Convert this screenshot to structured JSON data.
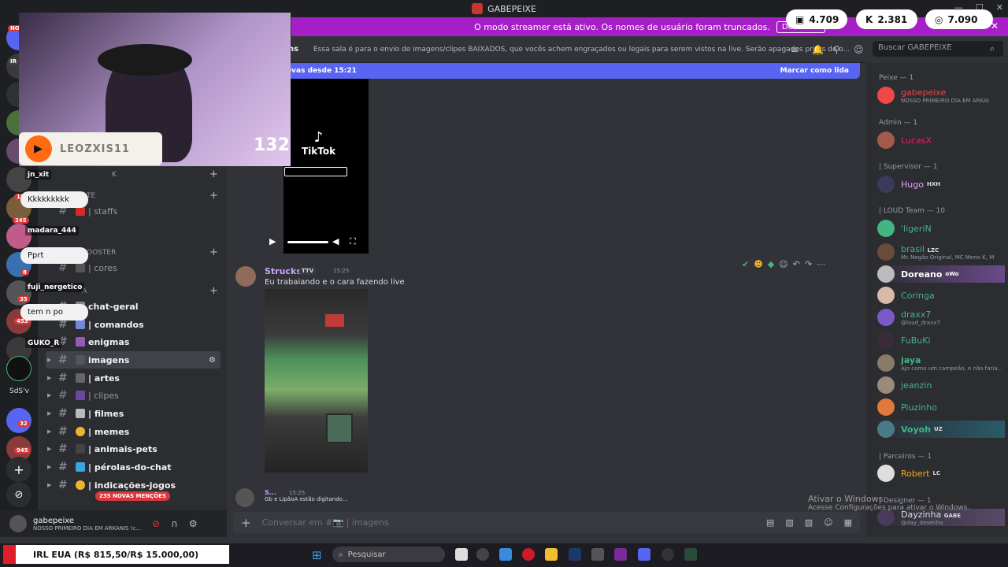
{
  "window": {
    "title": "GABEPEIXE",
    "controls": [
      "—",
      "☐",
      "✕"
    ]
  },
  "banner": {
    "text": "O modo streamer está ativo. Os nomes de usuário foram truncados.",
    "button": "Desativar",
    "close": "✕"
  },
  "stats": [
    {
      "icon": "twitch-icon",
      "value": "4.709"
    },
    {
      "icon": "kick-icon",
      "value": "2.381"
    },
    {
      "icon": "viewers-icon",
      "value": "7.090"
    }
  ],
  "servers": {
    "badges": [
      "NO",
      "IR",
      "245",
      "12",
      "8",
      "35",
      "453",
      "945",
      "32"
    ],
    "labels": [
      "SdS'v"
    ]
  },
  "channels": {
    "categories": [
      "K",
      "TE",
      "BOOSTER",
      "A"
    ],
    "items": [
      {
        "name": "| staffs",
        "bold": false
      },
      {
        "name": "| cores",
        "bold": false
      },
      {
        "name": "chat-geral",
        "bold": true
      },
      {
        "name": "| comandos",
        "bold": true
      },
      {
        "name": "enigmas",
        "bold": true
      },
      {
        "name": "imagens",
        "bold": true,
        "active": true
      },
      {
        "name": "| artes",
        "bold": true
      },
      {
        "name": "| clipes",
        "bold": false
      },
      {
        "name": "| filmes",
        "bold": true
      },
      {
        "name": "| memes",
        "bold": true
      },
      {
        "name": "| animais-pets",
        "bold": true
      },
      {
        "name": "| pérolas-do-chat",
        "bold": true
      },
      {
        "name": "| indicações-jogos",
        "bold": true
      }
    ],
    "mentions": "235 NOVAS MENÇÕES"
  },
  "user": {
    "name": "gabepeixe",
    "status": "NOSSO PRIMEIRO DIA EM ARKANIS !c..."
  },
  "stream": {
    "label": "LEOZXIS11",
    "count": "132",
    "tiktok": "TikTok"
  },
  "chat_overlay": [
    {
      "user": "jn_xit"
    },
    {
      "message": "Kkkkkkkkk"
    },
    {
      "user": "madara_444"
    },
    {
      "message": "Pprt"
    },
    {
      "user": "fuji_nergetico"
    },
    {
      "message": "tem n po"
    },
    {
      "user": "GUKO_R"
    }
  ],
  "topbar": {
    "channel": "ns",
    "topic": "Essa sala é para o envio de imagens/clipes BAIXADOS, que vocês achem engraçados ou legais para serem vistos na live. Serão apagados prints de o...",
    "search_placeholder": "Buscar GABEPEIXE"
  },
  "newbar": {
    "left": "ovas desde 15:21",
    "right": "Marcar como lida"
  },
  "message": {
    "author": "Strucks",
    "tag": "TTV",
    "time": "15:25",
    "text": "Eu trabaiando e o cara fazendo live"
  },
  "next_message": {
    "author": "S...",
    "time": "15:25",
    "typing": "Gb  e LipãoA estão digitando..."
  },
  "composer": {
    "placeholder": "Conversar em #📷 | imagens"
  },
  "members": {
    "roles": [
      {
        "label": "Peixe — 1",
        "members": [
          {
            "name": "gabepeixe",
            "status": "NOSSO PRIMEIRO DIA EM ARKAI",
            "color": "#f04747"
          }
        ]
      },
      {
        "label": "Admin — 1",
        "members": [
          {
            "name": "LucasX",
            "status": "",
            "color": "#e91e63"
          }
        ]
      },
      {
        "label": "| Supervisor — 1",
        "members": [
          {
            "name": "Hugo",
            "tag": "HXH",
            "status": "",
            "color": "#e8a2ff"
          }
        ]
      },
      {
        "label": "| LOUD Team — 10",
        "members": [
          {
            "name": "'ligeriN",
            "status": "",
            "color": "#43b581"
          },
          {
            "name": "brasil",
            "tag": "LZC",
            "status": "Mc Negão Original, MC Meno K, M",
            "color": "#43b581"
          },
          {
            "name": "Doreano",
            "tag": "oWo",
            "status": "",
            "color": "#43b581"
          },
          {
            "name": "Coringa",
            "status": "",
            "color": "#43b581"
          },
          {
            "name": "draxx7",
            "status": "@loud_draxx7",
            "color": "#43b581"
          },
          {
            "name": "FuBuKi",
            "status": "",
            "color": "#43b581"
          },
          {
            "name": "jaya",
            "status": "Ajo como um campeão, e não faria...",
            "color": "#43b581"
          },
          {
            "name": "jeanzin",
            "status": "",
            "color": "#43b581"
          },
          {
            "name": "Piuzinho",
            "status": "",
            "color": "#43b581"
          },
          {
            "name": "Voyoh",
            "tag": "UZ",
            "status": "",
            "color": "#43b581"
          }
        ]
      },
      {
        "label": "| Parceiros — 1",
        "members": [
          {
            "name": "Robert",
            "tag": "LC",
            "status": "",
            "color": "#faa61a"
          }
        ]
      },
      {
        "label": "| Designer — 1",
        "members": [
          {
            "name": "Dayzinha",
            "tag": "GABE",
            "status": "@day_desenha",
            "color": "#dbdee1"
          }
        ]
      }
    ]
  },
  "taskbar": {
    "irl": "IRL EUA (R$ 815,50/R$ 15.000,00)",
    "search": "Pesquisar"
  },
  "watermark": {
    "title": "Ativar o Windows",
    "subtitle": "Acesse Configurações para ativar o Windows."
  }
}
